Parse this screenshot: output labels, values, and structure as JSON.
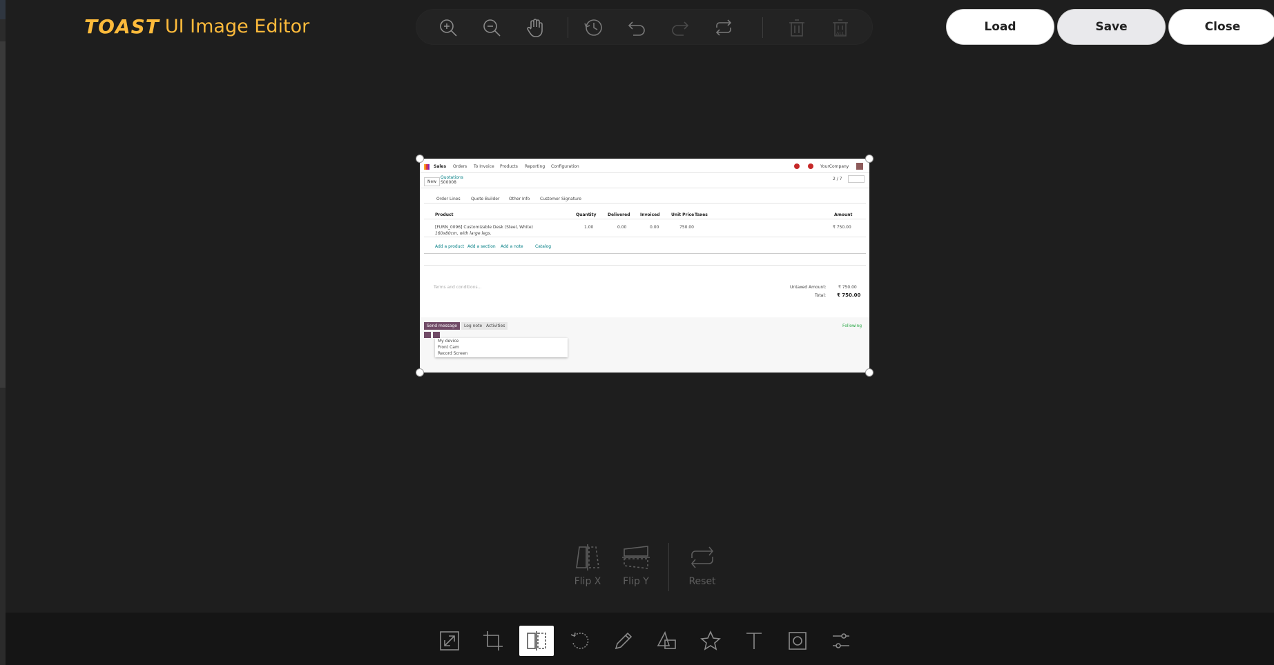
{
  "header": {
    "logo_brand": "TOAST",
    "logo_rest": "UI Image Editor",
    "buttons": {
      "load": "Load",
      "save": "Save",
      "close": "Close"
    }
  },
  "top_menu": {
    "icons": [
      "zoom-in-icon",
      "zoom-out-icon",
      "hand-icon",
      "history-icon",
      "undo-icon",
      "redo-icon",
      "reset-icon",
      "delete-icon",
      "delete-all-icon"
    ],
    "delete_all_label": "ALL"
  },
  "submenu": {
    "flip_x": "Flip X",
    "flip_y": "Flip Y",
    "reset": "Reset"
  },
  "bottom_toolbar": {
    "tools": [
      "resize",
      "crop",
      "flip",
      "rotate",
      "draw",
      "shape",
      "icon",
      "text",
      "mask",
      "filter"
    ],
    "active": "flip"
  },
  "canvas_image": {
    "nav": {
      "app": "Sales",
      "items": [
        "Orders",
        "To Invoice",
        "Products",
        "Reporting",
        "Configuration"
      ],
      "company": "YourCompany"
    },
    "control": {
      "new_label": "New",
      "breadcrumb": "Quotations",
      "record": "S00008",
      "pager": "2 / 7"
    },
    "tabs": [
      "Order Lines",
      "Quote Builder",
      "Other Info",
      "Customer Signature"
    ],
    "columns": [
      "Product",
      "Quantity",
      "Delivered",
      "Invoiced",
      "Unit Price",
      "Taxes",
      "Amount"
    ],
    "line": {
      "product": "[FURN_0096] Customizable Desk (Steel, White)",
      "description": "160x80cm, with large legs.",
      "quantity": "1.00",
      "delivered": "0.00",
      "invoiced": "0.00",
      "unit_price": "750.00",
      "amount": "₹ 750.00"
    },
    "add_links": [
      "Add a product",
      "Add a section",
      "Add a note",
      "Catalog"
    ],
    "terms_placeholder": "Terms and conditions...",
    "untaxed_label": "Untaxed Amount:",
    "untaxed_value": "₹ 750.00",
    "total_label": "Total:",
    "total_value": "₹ 750.00",
    "chatter": {
      "send": "Send message",
      "log": "Log note",
      "activities": "Activities",
      "following": "Following"
    },
    "dropdown": [
      "My device",
      "Front Cam",
      "Record Screen"
    ]
  }
}
